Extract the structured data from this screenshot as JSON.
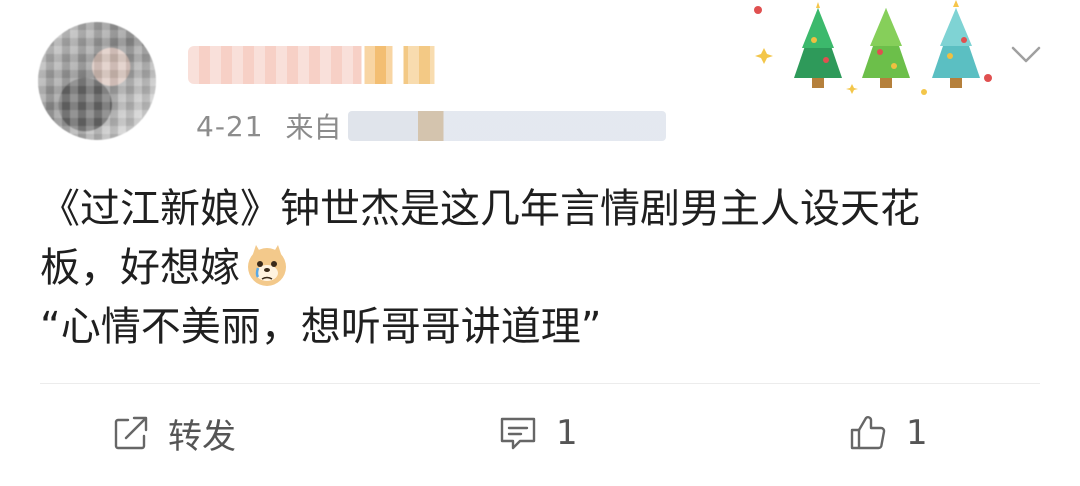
{
  "post": {
    "date": "4-21",
    "source_prefix": "来自",
    "content_line1": "《过江新娘》钟世杰是这几年言情剧男主人设天花",
    "content_line2": "板，好想嫁",
    "content_emoji": "crying-doge-emoji",
    "content_line3": "“心情不美丽，想听哥哥讲道理”"
  },
  "actions": {
    "repost_label": "转发",
    "comment_count": "1",
    "like_count": "1"
  },
  "icons": {
    "repost": "repost-icon",
    "comment": "comment-icon",
    "like": "thumbs-up-icon",
    "more": "chevron-down-icon",
    "decoration": "christmas-trees-decoration"
  },
  "colors": {
    "text": "#1f1f1f",
    "meta": "#8c8c8c",
    "action": "#555555",
    "divider": "#ececec"
  }
}
